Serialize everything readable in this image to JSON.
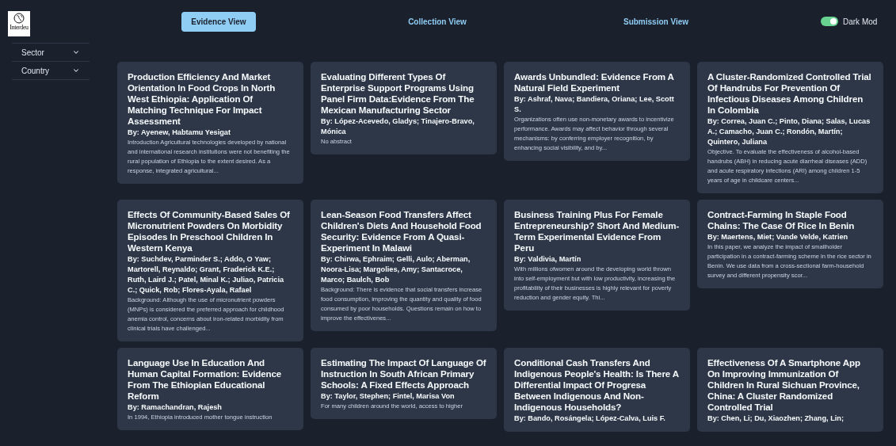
{
  "logo": {
    "text": "Interdeu"
  },
  "nav": [
    {
      "label": "Evidence View",
      "selected": true
    },
    {
      "label": "Collection View",
      "selected": false
    },
    {
      "label": "Submission View",
      "selected": false
    }
  ],
  "dark_mode": {
    "label": "Dark Mod",
    "on": true
  },
  "filters": [
    {
      "label": "Sector"
    },
    {
      "label": "Country"
    }
  ],
  "cards": [
    {
      "title": "Production Efficiency And Market Orientation In Food Crops In North West Ethiopia: Application Of Matching Technique For Impact Assessment",
      "authors": "By: Ayenew, Habtamu Yesigat",
      "abstract": "Introduction Agricultural technologies developed by national and international research institutions were not benefiting the rural population of Ethiopia to the extent desired. As a response, integrated agricultural..."
    },
    {
      "title": "Evaluating Different Types Of Enterprise Support Programs Using Panel Firm Data:Evidence From The Mexican Manufacturing Sector",
      "authors": "By: López-Acevedo, Gladys; Tinajero-Bravo, Mónica",
      "abstract": "No abstract"
    },
    {
      "title": "Awards Unbundled: Evidence From A Natural Field Experiment",
      "authors": "By: Ashraf, Nava; Bandiera, Oriana; Lee, Scott S.",
      "abstract": "Organizations often use non-monetary awards to incentivize performance. Awards may affect behavior through several mechanisms: by conferring employer recognition, by enhancing social visibility, and by..."
    },
    {
      "title": "A Cluster-Randomized Controlled Trial Of Handrubs For Prevention Of Infectious Diseases Among Children In Colombia",
      "authors": "By: Correa, Juan C.; Pinto, Diana; Salas, Lucas A.; Camacho, Juan C.; Rondón, Martín; Quintero, Juliana",
      "abstract": "Objective. To evaluate the effectiveness of alcohol-based handrubs (ABH) in reducing acute diarrheal diseases (ADD) and acute respiratory infections (ARI) among children 1-5 years of age in childcare centers..."
    },
    {
      "title": "Effects Of Community-Based Sales Of Micronutrient Powders On Morbidity Episodes In Preschool Children In Western Kenya",
      "authors": "By: Suchdev, Parminder S.; Addo, O Yaw; Martorell, Reynaldo; Grant, Fraderick K.E.; Ruth, Laird J.; Patel, Minal K.; Juliao, Patricia C.; Quick, Rob; Flores-Ayala, Rafael",
      "abstract": "Background: Although the use of micronutrient powders (MNPs) is considered the preferred approach for childhood anemia control, concerns about iron-related morbidity from clinical trials have challenged..."
    },
    {
      "title": "Lean-Season Food Transfers Affect Children's Diets And Household Food Security: Evidence From A Quasi-Experiment In Malawi",
      "authors": "By: Chirwa, Ephraim; Gelli, Aulo; Aberman, Noora-Lisa; Margolies, Amy; Santacroce, Marco; Baulch, Bob",
      "abstract": "Background: There is evidence that social transfers increase food consumption, improving the quantity and quality of food consumed by poor households. Questions remain on how to improve the effectivenes..."
    },
    {
      "title": "Business Training Plus For Female Entrepreneurship? Short And Medium-Term Experimental Evidence From Peru",
      "authors": "By: Valdivia, Martín",
      "abstract": "With millions ofwomen around the developing world thrown into self-employment but with low productivity, increasing the profitability of their businesses is highly relevant for poverty reduction and gender equity. Thi..."
    },
    {
      "title": "Contract-Farming In Staple Food Chains: The Case Of Rice In Benin",
      "authors": "By: Maertens, Miet; Vande Velde, Katrien",
      "abstract": "In this paper, we analyze the impact of smallholder participation in a contract-farming scheme in the rice sector in Benin. We use data from a cross-sectional farm-household survey and different propensity scor..."
    },
    {
      "title": "Language Use In Education And Human Capital Formation: Evidence From The Ethiopian Educational Reform",
      "authors": "By: Ramachandran, Rajesh",
      "abstract": "In 1994, Ethiopia introduced mother tongue instruction"
    },
    {
      "title": "Estimating The Impact Of Language Of Instruction In South African Primary Schools: A Fixed Effects Approach",
      "authors": "By: Taylor, Stephen; Fintel, Marisa Von",
      "abstract": "For many children around the world, access to higher"
    },
    {
      "title": "Conditional Cash Transfers And Indigenous People's Health: Is There A Differential Impact Of Progresa Between Indigenous And Non-Indigenous Households?",
      "authors": "By: Bando, Rosángela; López-Calva, Luis F."
    },
    {
      "title": "Effectiveness Of A Smartphone App On Improving Immunization Of Children In Rural Sichuan Province, China: A Cluster Randomized Controlled Trial",
      "authors": "By: Chen, Li; Du, Xiaozhen; Zhang, Lin;"
    }
  ]
}
